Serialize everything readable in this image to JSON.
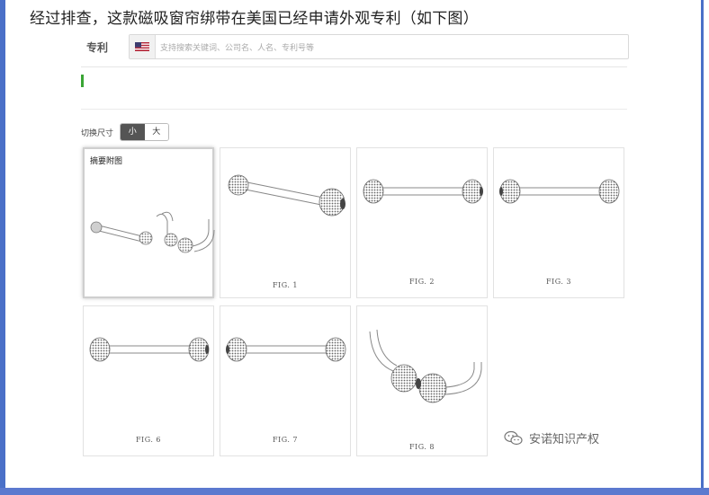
{
  "article": {
    "headline": "经过排查，这款磁吸窗帘绑带在美国已经申请外观专利（如下图）"
  },
  "search": {
    "section_label": "专利",
    "country_flag": "us-flag-icon",
    "placeholder": "支持搜索关键词、公司名、人名、专利号等"
  },
  "size_switch": {
    "label": "切换尺寸",
    "options": [
      "小",
      "大"
    ],
    "selected": "小"
  },
  "figures": [
    {
      "title": "摘要附图",
      "label": ""
    },
    {
      "title": "",
      "label": "FIG. 1"
    },
    {
      "title": "",
      "label": "FIG. 2"
    },
    {
      "title": "",
      "label": "FIG. 3"
    },
    {
      "title": "",
      "label": "FIG. 6"
    },
    {
      "title": "",
      "label": "FIG. 7"
    },
    {
      "title": "",
      "label": "FIG. 8"
    }
  ],
  "watermark": {
    "text": "安诺知识产权",
    "icon": "wechat-icon"
  },
  "colors": {
    "frame": "#4a70c8",
    "accent_green": "#3aa535",
    "toggle_active": "#555555"
  }
}
